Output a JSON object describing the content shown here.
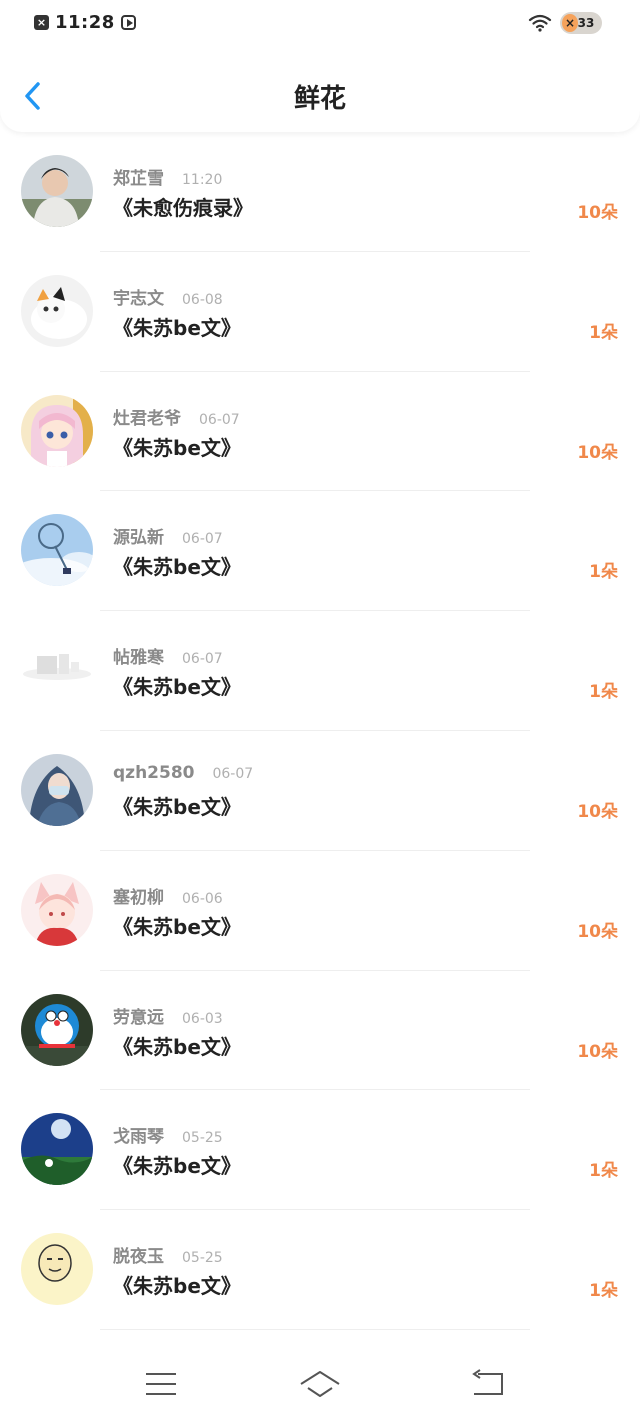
{
  "status_bar": {
    "time": "11:28",
    "notif_symbol": "×",
    "battery": "33"
  },
  "header": {
    "title": "鲜花"
  },
  "rows": [
    {
      "name": "郑芷雪",
      "time": "11:20",
      "book": "《未愈伤痕录》",
      "flowers": "10朵"
    },
    {
      "name": "宇志文",
      "time": "06-08",
      "book": "《朱苏be文》",
      "flowers": "1朵"
    },
    {
      "name": "灶君老爷",
      "time": "06-07",
      "book": "《朱苏be文》",
      "flowers": "10朵"
    },
    {
      "name": "源弘新",
      "time": "06-07",
      "book": "《朱苏be文》",
      "flowers": "1朵"
    },
    {
      "name": "帖雅寒",
      "time": "06-07",
      "book": "《朱苏be文》",
      "flowers": "1朵"
    },
    {
      "name": "qzh2580",
      "time": "06-07",
      "book": "《朱苏be文》",
      "flowers": "10朵"
    },
    {
      "name": "塞初柳",
      "time": "06-06",
      "book": "《朱苏be文》",
      "flowers": "10朵"
    },
    {
      "name": "劳意远",
      "time": "06-03",
      "book": "《朱苏be文》",
      "flowers": "10朵"
    },
    {
      "name": "戈雨琴",
      "time": "05-25",
      "book": "《朱苏be文》",
      "flowers": "1朵"
    },
    {
      "name": "脱夜玉",
      "time": "05-25",
      "book": "《朱苏be文》",
      "flowers": "1朵"
    }
  ],
  "colors": {
    "accent": "#2196f3",
    "flowers": "#f0884a"
  },
  "icons": {
    "back": "back-arrow-icon",
    "menu": "menu-icon",
    "home": "home-icon",
    "return": "return-icon"
  }
}
